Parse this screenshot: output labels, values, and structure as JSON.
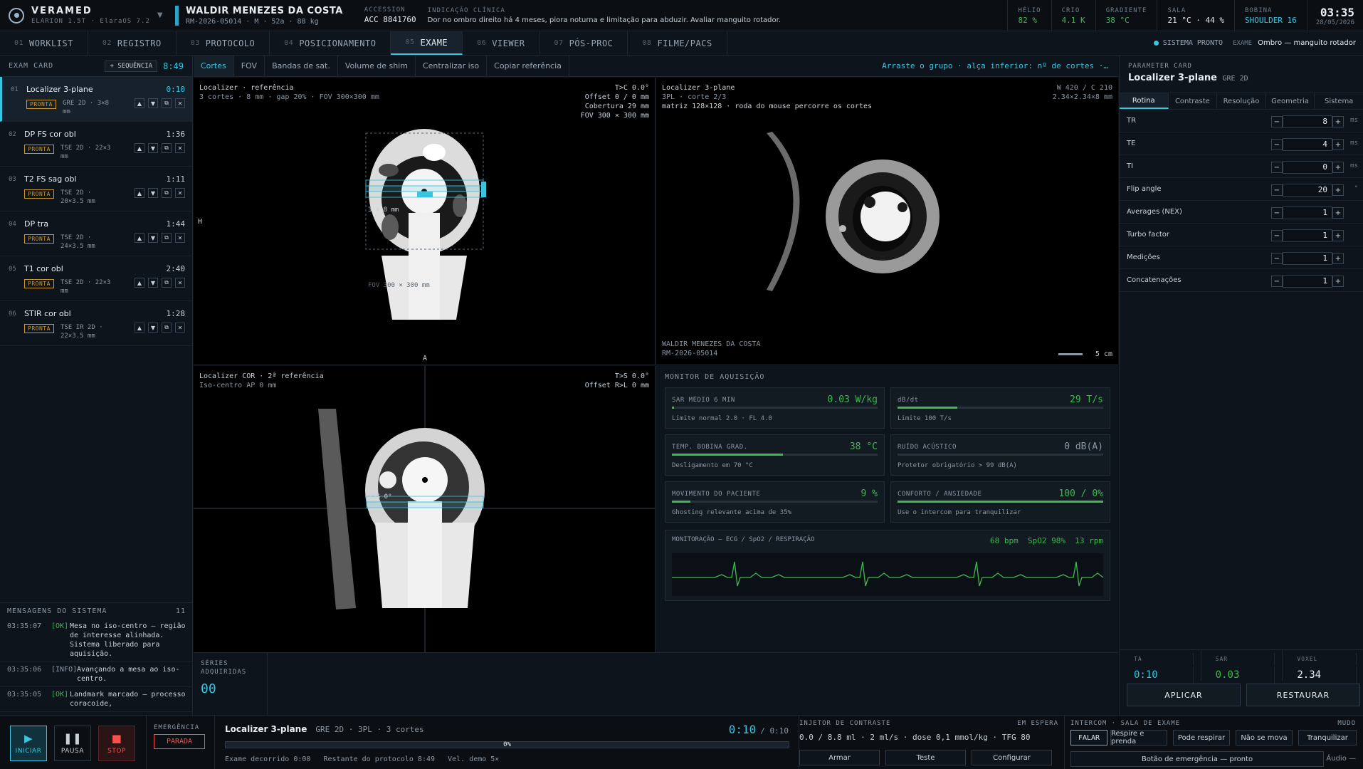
{
  "app": {
    "brand": "VERAMED",
    "system": "ELARION 1.5T · ElaraOS 7.2"
  },
  "patient": {
    "name": "WALDIR MENEZES DA COSTA",
    "meta": "RM-2026-05014 · M · 52a · 88 kg"
  },
  "accession": {
    "label": "ACCESSION",
    "value": "ACC 8841760"
  },
  "clinical": {
    "label": "INDICAÇÃO CLÍNICA",
    "text": "Dor no ombro direito há 4 meses, piora noturna e limitação para abduzir. Avaliar manguito rotador."
  },
  "stats": [
    {
      "label": "HÉLIO",
      "value": "82 %"
    },
    {
      "label": "CRIO",
      "value": "4.1 K"
    },
    {
      "label": "GRADIENTE",
      "value": "38 °C"
    },
    {
      "label": "SALA",
      "value": "21 °C · 44 %"
    },
    {
      "label": "BOBINA",
      "value": "SHOULDER 16"
    }
  ],
  "clock": {
    "time": "03:35",
    "date": "28/05/2026"
  },
  "nav": {
    "tabs": [
      {
        "num": "01",
        "label": "WORKLIST"
      },
      {
        "num": "02",
        "label": "REGISTRO"
      },
      {
        "num": "03",
        "label": "PROTOCOLO"
      },
      {
        "num": "04",
        "label": "POSICIONAMENTO"
      },
      {
        "num": "05",
        "label": "EXAME"
      },
      {
        "num": "06",
        "label": "VIEWER"
      },
      {
        "num": "07",
        "label": "PÓS-PROC"
      },
      {
        "num": "08",
        "label": "FILME/PACS"
      }
    ],
    "status": "SISTEMA PRONTO",
    "exam_label": "EXAME",
    "exam_value": "Ombro — manguito rotador"
  },
  "examcard": {
    "title": "EXAM CARD",
    "add_label": "+ SEQUÊNCIA",
    "total": "8:49",
    "sequences": [
      {
        "num": "01",
        "name": "Localizer 3-plane",
        "dur": "0:10",
        "status": "PRONTA",
        "detail": "GRE 2D · 3×8 mm"
      },
      {
        "num": "02",
        "name": "DP FS cor obl",
        "dur": "1:36",
        "status": "PRONTA",
        "detail": "TSE 2D · 22×3 mm"
      },
      {
        "num": "03",
        "name": "T2 FS sag obl",
        "dur": "1:11",
        "status": "PRONTA",
        "detail": "TSE 2D · 20×3.5 mm"
      },
      {
        "num": "04",
        "name": "DP tra",
        "dur": "1:44",
        "status": "PRONTA",
        "detail": "TSE 2D · 24×3.5 mm"
      },
      {
        "num": "05",
        "name": "T1 cor obl",
        "dur": "2:40",
        "status": "PRONTA",
        "detail": "TSE 2D · 22×3 mm"
      },
      {
        "num": "06",
        "name": "STIR cor obl",
        "dur": "1:28",
        "status": "PRONTA",
        "detail": "TSE IR 2D · 22×3.5 mm"
      }
    ]
  },
  "messages": {
    "title": "MENSAGENS DO SISTEMA",
    "count": "11",
    "items": [
      {
        "time": "03:35:07",
        "level": "[OK]",
        "text": "Mesa no iso-centro — região de interesse alinhada. Sistema liberado para aquisição."
      },
      {
        "time": "03:35:06",
        "level": "[INFO]",
        "text": "Avançando a mesa ao iso-centro."
      },
      {
        "time": "03:35:05",
        "level": "[OK]",
        "text": "Landmark marcado — processo coracoide,"
      }
    ]
  },
  "toolbar": {
    "tools": [
      "Cortes",
      "FOV",
      "Bandas de sat.",
      "Volume de shim",
      "Centralizar iso",
      "Copiar referência"
    ],
    "hint": "Arraste o grupo · alça inferior: nº de cortes ·…"
  },
  "vp1": {
    "title": "Localizer · referência",
    "sub": "3 cortes · 8 mm · gap 20% · FOV 300×300 mm",
    "r1": "T>C 0.0°",
    "r2": "Offset 0 / 0 mm",
    "r3": "Cobertura 29 mm",
    "r4": "FOV 300 × 300 mm",
    "label_h": "H",
    "label_a": "A",
    "slice_label": "3 × 8 mm",
    "fov_label": "FOV 300 × 300 mm"
  },
  "vp2": {
    "title": "Localizer 3-plane",
    "sub": "3PL · corte 2/3",
    "sub2": "matriz 128×128 · roda do mouse percorre os cortes",
    "r1": "W 420 / C 210",
    "r2": "2.34×2.34×8 mm",
    "patient": "WALDIR MENEZES DA COSTA",
    "id": "RM-2026-05014",
    "scale": "5 cm"
  },
  "vp3": {
    "title": "Localizer COR · 2ª referência",
    "sub": "Iso-centro AP 0 mm",
    "r1": "T>S 0.0°",
    "r2": "Offset R>L 0 mm",
    "slice_label": "T>S 0°"
  },
  "monitor": {
    "title": "MONITOR DE AQUISIÇÃO",
    "cards": [
      {
        "label": "SAR MÉDIO 6 MIN",
        "value": "0.03 W/kg",
        "sub": "Limite normal 2.0 · FL 4.0",
        "level": 0.01
      },
      {
        "label": "dB/dt",
        "value": "29 T/s",
        "sub": "Limite 100 T/s",
        "level": 0.29
      },
      {
        "label": "TEMP. BOBINA GRAD.",
        "value": "38 °C",
        "sub": "Desligamento em 70 °C",
        "level": 0.54
      },
      {
        "label": "RUÍDO ACÚSTICO",
        "value": "0 dB(A)",
        "sub": "Protetor obrigatório > 99 dB(A)",
        "level": 0
      },
      {
        "label": "MOVIMENTO DO PACIENTE",
        "value": "9 %",
        "sub": "Ghosting relevante acima de 35%",
        "level": 0.09
      },
      {
        "label": "CONFORTO / ANSIEDADE",
        "value": "100 / 0%",
        "sub": "Use o intercom para tranquilizar",
        "level": 1.0
      }
    ],
    "ecg_label": "MONITORAÇÃO — ECG / SpO2 / RESPIRAÇÃO",
    "ecg_values": "68 bpm  SpO2 98%  13 rpm"
  },
  "series": {
    "label1": "SÉRIES",
    "label2": "ADQUIRIDAS",
    "value": "00"
  },
  "params": {
    "title": "PARAMETER CARD",
    "seq_name": "Localizer 3-plane",
    "seq_type": "GRE 2D",
    "tabs": [
      "Rotina",
      "Contraste",
      "Resolução",
      "Geometria",
      "Sistema"
    ],
    "rows": [
      {
        "label": "TR",
        "value": "8",
        "unit": "ms"
      },
      {
        "label": "TE",
        "value": "4",
        "unit": "ms"
      },
      {
        "label": "TI",
        "value": "0",
        "unit": "ms"
      },
      {
        "label": "Flip angle",
        "value": "20",
        "unit": "°"
      },
      {
        "label": "Averages (NEX)",
        "value": "1",
        "unit": ""
      },
      {
        "label": "Turbo factor",
        "value": "1",
        "unit": ""
      },
      {
        "label": "Medições",
        "value": "1",
        "unit": ""
      },
      {
        "label": "Concatenações",
        "value": "1",
        "unit": ""
      }
    ],
    "summary": [
      {
        "label": "TA",
        "value": "0:10"
      },
      {
        "label": "SAR",
        "value": "0.03"
      },
      {
        "label": "VOXEL",
        "value": "2.34"
      }
    ],
    "apply": "APLICAR",
    "restore": "RESTAURAR"
  },
  "bottom": {
    "start": "INICIAR",
    "pause": "PAUSA",
    "stop": "STOP",
    "emergency_label": "EMERGÊNCIA",
    "emergency_state": "PARADA",
    "current_seq": "Localizer 3-plane",
    "current_detail": "GRE 2D · 3PL · 3 cortes",
    "elapsed": "0:10",
    "total": "/ 0:10",
    "progress": "0%",
    "progress_level": 0,
    "footer": "Exame decorrido 0:00   Restante do protocolo 8:49   Vel. demo 5×",
    "injector": {
      "title": "INJETOR DE CONTRASTE",
      "state": "EM ESPERA",
      "info": "0.0 / 8.8 ml · 2 ml/s · dose 0,1 mmol/kg · TFG 80",
      "arm": "Armar",
      "test": "Teste",
      "config": "Configurar"
    },
    "intercom": {
      "title": "INTERCOM · SALA DE EXAME",
      "mute": "MUDO",
      "buttons": [
        "FALAR",
        "Respire e prenda",
        "Pode respirar",
        "Não se mova",
        "Tranquilizar"
      ],
      "emergency": "Botão de emergência — pronto",
      "audio": "Áudio —"
    }
  }
}
